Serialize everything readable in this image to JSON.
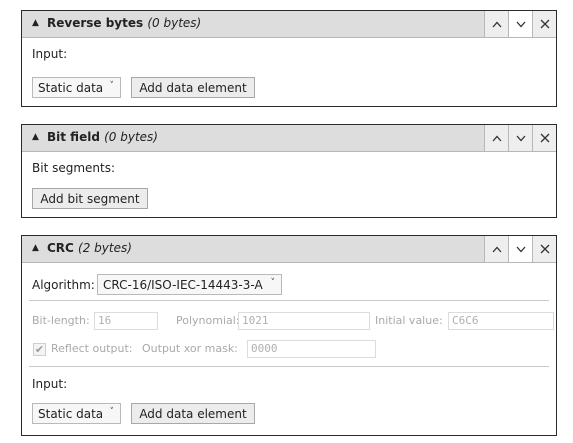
{
  "panels": [
    {
      "title": "Reverse bytes",
      "subtitle": "(0 bytes)",
      "input_label": "Input:",
      "source_select": "Static data",
      "add_button": "Add data element"
    },
    {
      "title": "Bit field",
      "subtitle": "(0 bytes)",
      "segments_label": "Bit segments:",
      "add_button": "Add bit segment"
    },
    {
      "title": "CRC",
      "subtitle": "(2 bytes)",
      "algorithm_label": "Algorithm:",
      "algorithm_value": "CRC-16/ISO-IEC-14443-3-A",
      "bit_length_label": "Bit-length:",
      "bit_length_value": "16",
      "polynomial_label": "Polynomial:",
      "polynomial_value": "1021",
      "initial_value_label": "Initial value:",
      "initial_value_value": "C6C6",
      "reflect_output_label": "Reflect output:",
      "reflect_output_checked": true,
      "output_xor_label": "Output xor mask:",
      "output_xor_value": "0000",
      "input_label": "Input:",
      "source_select": "Static data",
      "add_button": "Add data element"
    }
  ],
  "glyphs": {
    "collapse": "▲",
    "dropdown": "˅",
    "checkmark": "✔"
  },
  "icons": [
    "collapse-triangle-icon",
    "chevron-up-icon",
    "chevron-down-icon",
    "close-icon",
    "dropdown-chevron-icon",
    "checkmark-icon"
  ]
}
